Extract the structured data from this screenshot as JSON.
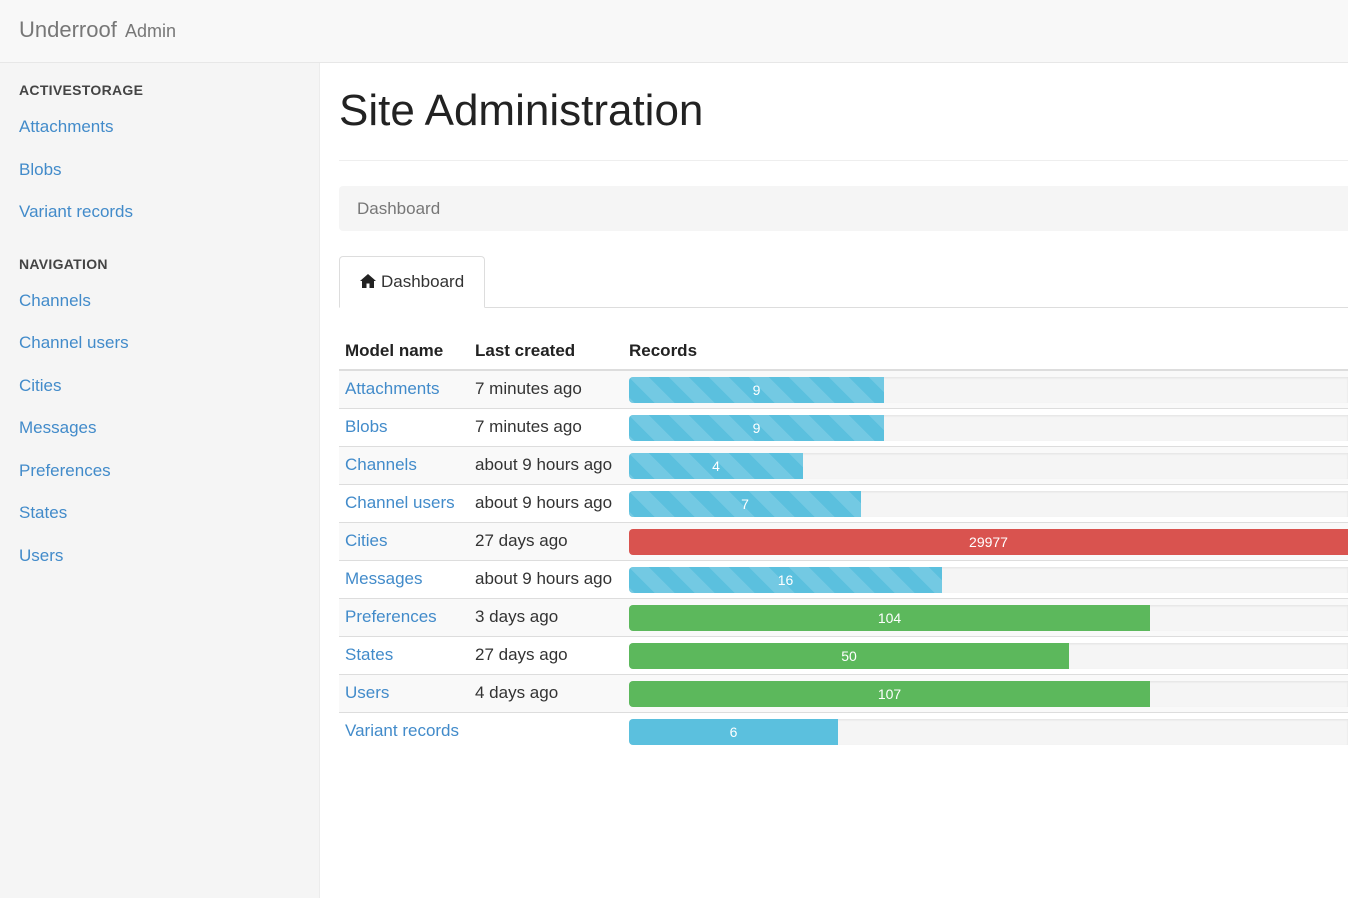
{
  "navbar": {
    "brand": "Underroof",
    "brand_sub": "Admin"
  },
  "sidebar": {
    "sections": [
      {
        "header": "ACTIVESTORAGE",
        "items": [
          "Attachments",
          "Blobs",
          "Variant records"
        ]
      },
      {
        "header": "NAVIGATION",
        "items": [
          "Channels",
          "Channel users",
          "Cities",
          "Messages",
          "Preferences",
          "States",
          "Users"
        ]
      }
    ]
  },
  "main": {
    "title": "Site Administration",
    "breadcrumb": "Dashboard",
    "tab": {
      "label": "Dashboard",
      "icon": "home-icon"
    },
    "table": {
      "headers": [
        "Model name",
        "Last created",
        "Records"
      ],
      "colors": {
        "info": "#5bc0de",
        "danger": "#d9534f",
        "success": "#5cb85c"
      },
      "rows": [
        {
          "name": "Attachments",
          "last_created": "7 minutes ago",
          "records": "9",
          "fill": 0.355,
          "status": "info",
          "striped": true
        },
        {
          "name": "Blobs",
          "last_created": "7 minutes ago",
          "records": "9",
          "fill": 0.355,
          "status": "info",
          "striped": true
        },
        {
          "name": "Channels",
          "last_created": "about 9 hours ago",
          "records": "4",
          "fill": 0.242,
          "status": "info",
          "striped": true
        },
        {
          "name": "Channel users",
          "last_created": "about 9 hours ago",
          "records": "7",
          "fill": 0.322,
          "status": "info",
          "striped": true
        },
        {
          "name": "Cities",
          "last_created": "27 days ago",
          "records": "29977",
          "fill": 1.0,
          "status": "danger",
          "striped": false
        },
        {
          "name": "Messages",
          "last_created": "about 9 hours ago",
          "records": "16",
          "fill": 0.435,
          "status": "info",
          "striped": true
        },
        {
          "name": "Preferences",
          "last_created": "3 days ago",
          "records": "104",
          "fill": 0.725,
          "status": "success",
          "striped": false
        },
        {
          "name": "States",
          "last_created": "27 days ago",
          "records": "50",
          "fill": 0.612,
          "status": "success",
          "striped": false
        },
        {
          "name": "Users",
          "last_created": "4 days ago",
          "records": "107",
          "fill": 0.725,
          "status": "success",
          "striped": false
        },
        {
          "name": "Variant records",
          "last_created": "",
          "records": "6",
          "fill": 0.29,
          "status": "info",
          "striped": false
        }
      ]
    }
  }
}
